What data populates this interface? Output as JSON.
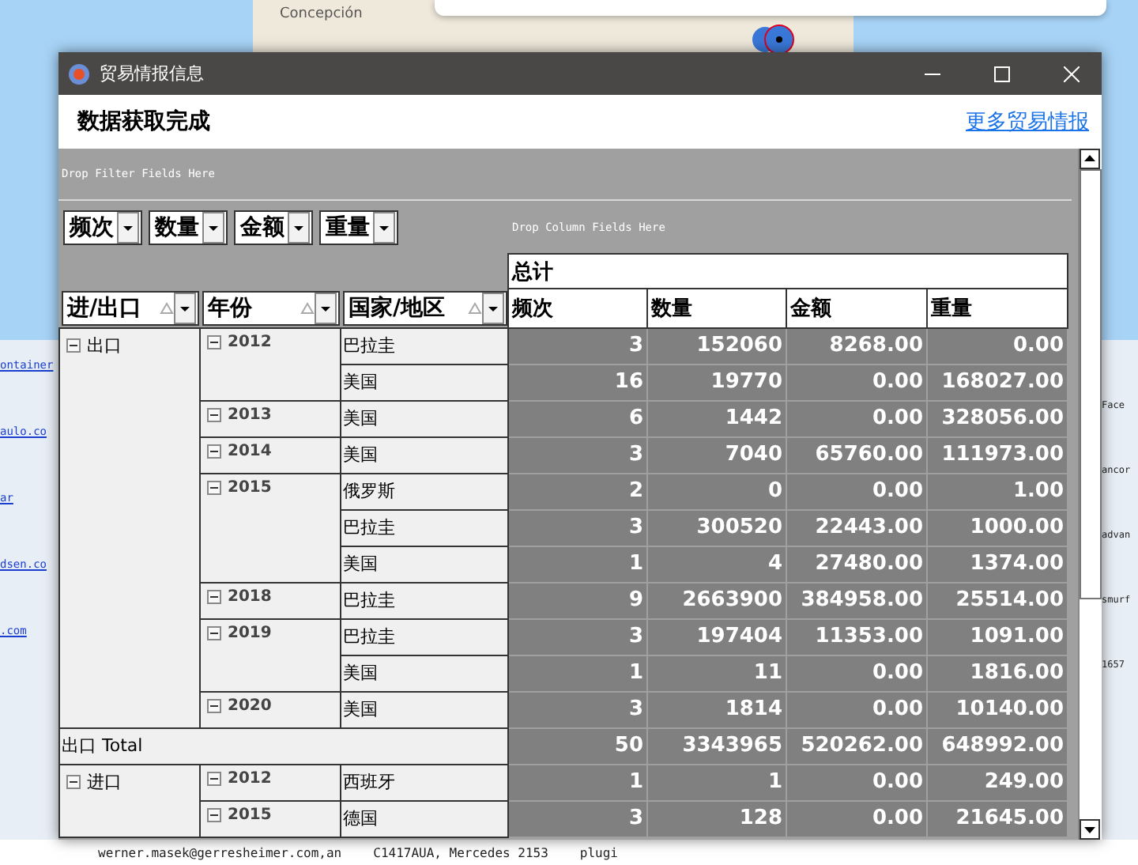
{
  "background": {
    "map_label": "Concepción",
    "left_texts": [
      "ontainer",
      "aulo.co",
      "ar",
      "dsen.co",
      ".com"
    ],
    "right_texts": [
      "Face",
      "ancor",
      "advan",
      "smurf",
      "1657"
    ],
    "bottom_texts": [
      "werner.masek@gerresheimer.com,an",
      "C1417AUA, Mercedes 2153",
      "plugi"
    ]
  },
  "window": {
    "title": "贸易情报信息"
  },
  "header": {
    "status": "数据获取完成",
    "link": "更多贸易情报"
  },
  "pivot": {
    "filter_hint": "Drop Filter Fields Here",
    "column_hint": "Drop Column Fields Here",
    "data_fields": [
      "频次",
      "数量",
      "金额",
      "重量"
    ],
    "row_fields": [
      "进/出口",
      "年份",
      "国家/地区"
    ],
    "column_total": "总计",
    "columns": [
      "频次",
      "数量",
      "金额",
      "重量"
    ],
    "groups": [
      {
        "label": "出口",
        "years": [
          {
            "year": "2012",
            "rows": [
              {
                "country": "巴拉圭",
                "values": [
                  "3",
                  "152060",
                  "8268.00",
                  "0.00"
                ]
              },
              {
                "country": "美国",
                "values": [
                  "16",
                  "19770",
                  "0.00",
                  "168027.00"
                ]
              }
            ]
          },
          {
            "year": "2013",
            "rows": [
              {
                "country": "美国",
                "values": [
                  "6",
                  "1442",
                  "0.00",
                  "328056.00"
                ]
              }
            ]
          },
          {
            "year": "2014",
            "rows": [
              {
                "country": "美国",
                "values": [
                  "3",
                  "7040",
                  "65760.00",
                  "111973.00"
                ]
              }
            ]
          },
          {
            "year": "2015",
            "rows": [
              {
                "country": "俄罗斯",
                "values": [
                  "2",
                  "0",
                  "0.00",
                  "1.00"
                ]
              },
              {
                "country": "巴拉圭",
                "values": [
                  "3",
                  "300520",
                  "22443.00",
                  "1000.00"
                ]
              },
              {
                "country": "美国",
                "values": [
                  "1",
                  "4",
                  "27480.00",
                  "1374.00"
                ]
              }
            ]
          },
          {
            "year": "2018",
            "rows": [
              {
                "country": "巴拉圭",
                "values": [
                  "9",
                  "2663900",
                  "384958.00",
                  "25514.00"
                ]
              }
            ]
          },
          {
            "year": "2019",
            "rows": [
              {
                "country": "巴拉圭",
                "values": [
                  "3",
                  "197404",
                  "11353.00",
                  "1091.00"
                ]
              },
              {
                "country": "美国",
                "values": [
                  "1",
                  "11",
                  "0.00",
                  "1816.00"
                ]
              }
            ]
          },
          {
            "year": "2020",
            "rows": [
              {
                "country": "美国",
                "values": [
                  "3",
                  "1814",
                  "0.00",
                  "10140.00"
                ]
              }
            ]
          }
        ],
        "total": {
          "label": "出口 Total",
          "values": [
            "50",
            "3343965",
            "520262.00",
            "648992.00"
          ]
        }
      },
      {
        "label": "进口",
        "years": [
          {
            "year": "2012",
            "rows": [
              {
                "country": "西班牙",
                "values": [
                  "1",
                  "1",
                  "0.00",
                  "249.00"
                ]
              }
            ]
          },
          {
            "year": "2015",
            "rows": [
              {
                "country": "德国",
                "values": [
                  "3",
                  "128",
                  "0.00",
                  "21645.00"
                ]
              }
            ]
          }
        ]
      }
    ]
  }
}
